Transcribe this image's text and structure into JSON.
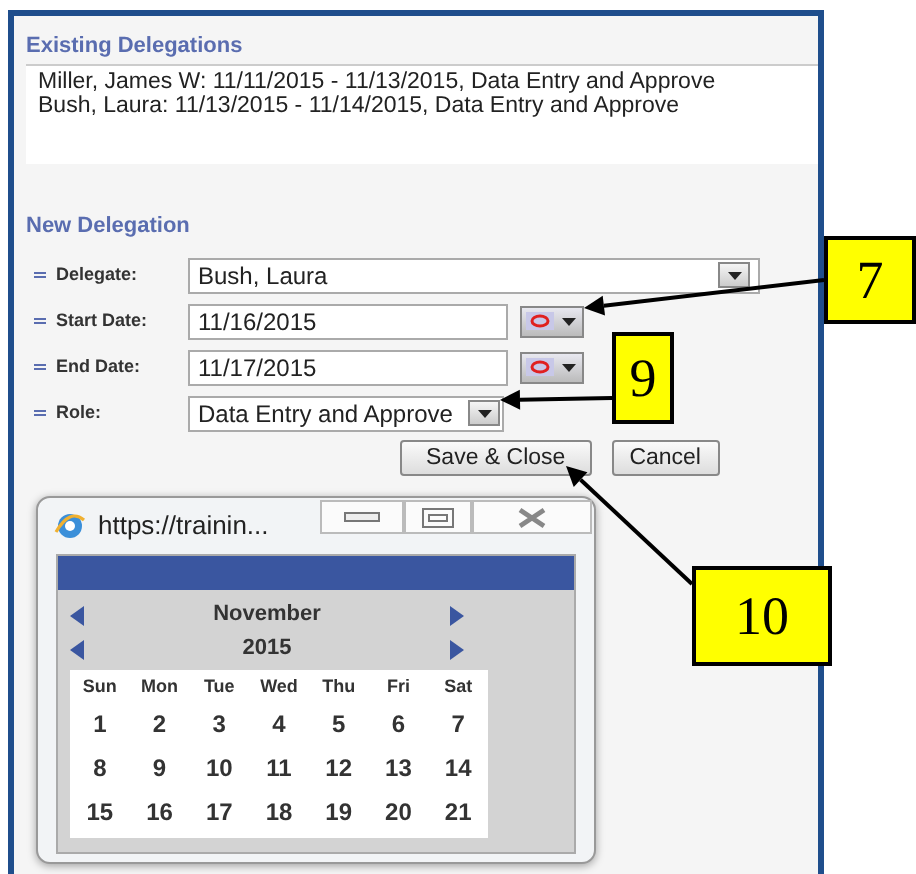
{
  "existing_delegations": {
    "title": "Existing Delegations",
    "entries": [
      "Miller, James W: 11/11/2015 - 11/13/2015, Data Entry and Approve",
      "Bush, Laura: 11/13/2015 - 11/14/2015, Data Entry and Approve"
    ]
  },
  "new_delegation": {
    "title": "New Delegation",
    "fields": [
      {
        "label": "Delegate:",
        "kind": "select",
        "value": "Bush, Laura"
      },
      {
        "label": "Start Date:",
        "kind": "date",
        "value": "11/16/2015"
      },
      {
        "label": "End Date:",
        "kind": "date",
        "value": "11/17/2015"
      },
      {
        "label": "Role:",
        "kind": "short-select",
        "value": "Data Entry and Approve"
      }
    ],
    "buttons": [
      "Save & Close",
      "Cancel"
    ]
  },
  "popup": {
    "title": "https://trainin...",
    "calendar": {
      "month": "November",
      "year": "2015",
      "weekdays": [
        "Sun",
        "Mon",
        "Tue",
        "Wed",
        "Thu",
        "Fri",
        "Sat"
      ],
      "weeks": [
        [
          "1",
          "2",
          "3",
          "4",
          "5",
          "6",
          "7"
        ],
        [
          "8",
          "9",
          "10",
          "11",
          "12",
          "13",
          "14"
        ],
        [
          "15",
          "16",
          "17",
          "18",
          "19",
          "20",
          "21"
        ]
      ]
    }
  },
  "callouts": [
    {
      "label": "7"
    },
    {
      "label": "9"
    },
    {
      "label": "10"
    }
  ]
}
